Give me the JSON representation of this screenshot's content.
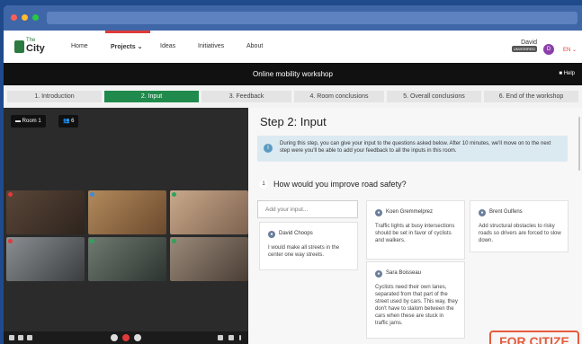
{
  "app": {
    "logo_the": "The",
    "logo_city": "City"
  },
  "nav": {
    "items": [
      "Home",
      "Projects ⌄",
      "Ideas",
      "Initiatives",
      "About"
    ]
  },
  "user": {
    "name": "David",
    "badge": "UNVERIFIED",
    "initial": "D",
    "lang": "EN ⌄"
  },
  "workshop": {
    "title": "Online mobility workshop",
    "help": "Help"
  },
  "steps": [
    {
      "label": "1. Introduction"
    },
    {
      "label": "2. Input"
    },
    {
      "label": "3. Feedback"
    },
    {
      "label": "4. Room conclusions"
    },
    {
      "label": "5. Overall conclusions"
    },
    {
      "label": "6. End of the workshop"
    }
  ],
  "video": {
    "room_label": "Room 1",
    "participants": "6"
  },
  "panel": {
    "heading": "Step 2: Input",
    "info": "During this step, you can give your input to the questions asked below. After 10 minutes, we'll move on to the next step were you'll be able to add your feedback to all the inputs in this room.",
    "qnum": "1",
    "question": "How would you improve road safety?",
    "input_placeholder": "Add your input...",
    "cards": [
      {
        "name": "David Choops",
        "text": "I would make all streets in the center one way streets."
      },
      {
        "name": "Koen Gremmelprez",
        "text": "Traffic lights at busy intersections should be set in favor of cyclists and walkers."
      },
      {
        "name": "Sara Boisseau",
        "text": "Cyclists need their own lanes, separated from that part of the street used by cars. This way, they don't have to slalom between the cars when these are stuck in traffic jams."
      },
      {
        "name": "Brent Gulfens",
        "text": "Add structural obstacles to risky roads so drivers are forced to slow down."
      }
    ]
  },
  "overlay_text": "FOR CITIZE",
  "colors": {
    "accent_green": "#1f8a4c",
    "accent_red": "#e03a3a",
    "info_bg": "#dbe9f1"
  }
}
